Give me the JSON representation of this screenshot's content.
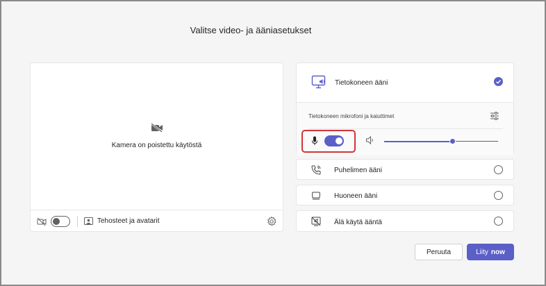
{
  "dialog": {
    "title": "Valitse video- ja ääniasetukset"
  },
  "camera": {
    "status_text": "Kamera on poistettu käytöstä",
    "toggle_on": false,
    "effects_label": "Tehosteet ja avatarit"
  },
  "audio": {
    "computer": {
      "label": "Tietokoneen ääni",
      "selected": true,
      "device_label": "Tietokoneen mikrofoni ja kaiuttimet",
      "mic_on": true,
      "volume_percent": 60
    },
    "options": [
      {
        "label": "Puhelimen ääni",
        "icon": "phone-icon",
        "selected": false
      },
      {
        "label": "Huoneen ääni",
        "icon": "room-audio-icon",
        "selected": false
      },
      {
        "label": "Älä käytä ääntä",
        "icon": "no-audio-icon",
        "selected": false
      }
    ]
  },
  "buttons": {
    "cancel_label": "Peruuta",
    "join_label": "Liity",
    "join_suffix": "now"
  },
  "colors": {
    "accent": "#5b5fc7",
    "highlight": "#d13438"
  }
}
